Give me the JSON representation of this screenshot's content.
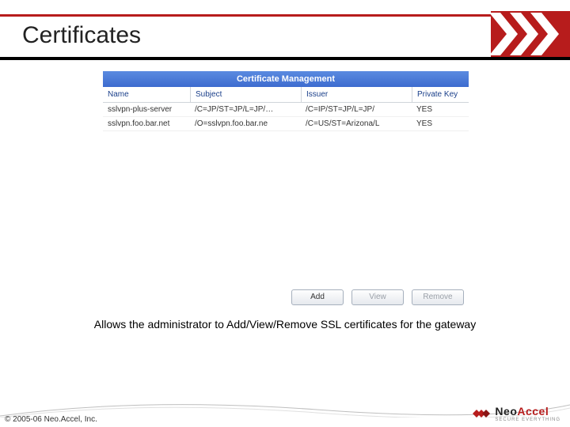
{
  "title": "Certificates",
  "panel": {
    "title": "Certificate Management",
    "columns": [
      "Name",
      "Subject",
      "Issuer",
      "Private Key"
    ],
    "rows": [
      {
        "name": "sslvpn-plus-server",
        "subject": "/C=JP/ST=JP/L=JP/…",
        "issuer": "/C=IP/ST=JP/L=JP/",
        "pkey": "YES"
      },
      {
        "name": "sslvpn.foo.bar.net",
        "subject": "/O=sslvpn.foo.bar.ne",
        "issuer": "/C=US/ST=Arizona/L",
        "pkey": "YES"
      }
    ],
    "buttons": {
      "add": "Add",
      "view": "View",
      "remove": "Remove"
    }
  },
  "caption": "Allows the administrator to Add/View/Remove SSL certificates for the gateway",
  "footer": {
    "copyright": "© 2005-06 Neo.Accel, Inc.",
    "logo_neo": "Neo",
    "logo_accel": "Accel",
    "tagline": "Secure Everything"
  }
}
